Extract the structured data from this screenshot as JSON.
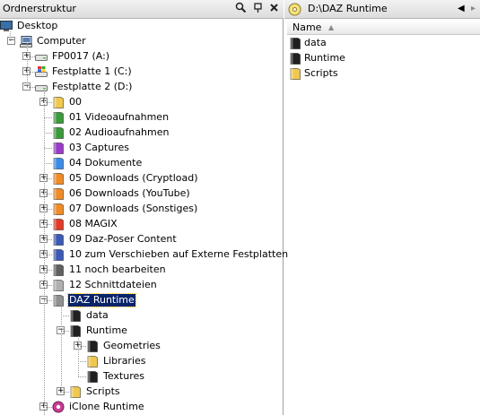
{
  "left_pane": {
    "title": "Ordnerstruktur",
    "buttons": [
      {
        "icon": "search-icon"
      },
      {
        "icon": "pin-icon"
      },
      {
        "icon": "close-icon"
      }
    ]
  },
  "tree": [
    {
      "label": "Desktop",
      "icon": "desktop-icon",
      "level": 0,
      "expander": "none",
      "color": "#3a6ea5"
    },
    {
      "label": "Computer",
      "icon": "computer-icon",
      "level": 1,
      "expander": "minus",
      "color": "#5b7fb0"
    },
    {
      "label": "FP0017 (A:)",
      "icon": "floppy-drive-icon",
      "level": 2,
      "expander": "plus",
      "color": "#a0a0a0"
    },
    {
      "label": "Festplatte 1 (C:)",
      "icon": "windows-drive-icon",
      "level": 2,
      "expander": "plus",
      "color": "#a0a0a0"
    },
    {
      "label": "Festplatte 2 (D:)",
      "icon": "hard-drive-icon",
      "level": 2,
      "expander": "minus",
      "color": "#a0a0a0"
    },
    {
      "label": "00",
      "icon": "folder-icon",
      "level": 3,
      "expander": "plus",
      "color": "#f0c850"
    },
    {
      "label": "01 Videoaufnahmen",
      "icon": "folder-icon",
      "level": 3,
      "expander": "none",
      "color": "#3c9a3c"
    },
    {
      "label": "02 Audioaufnahmen",
      "icon": "folder-icon",
      "level": 3,
      "expander": "none",
      "color": "#3c9a3c"
    },
    {
      "label": "03 Captures",
      "icon": "folder-icon",
      "level": 3,
      "expander": "none",
      "color": "#9a3cc8"
    },
    {
      "label": "04 Dokumente",
      "icon": "folder-icon",
      "level": 3,
      "expander": "none",
      "color": "#3c8ce6"
    },
    {
      "label": "05 Downloads (Cryptload)",
      "icon": "folder-icon",
      "level": 3,
      "expander": "plus",
      "color": "#f08c28"
    },
    {
      "label": "06 Downloads (YouTube)",
      "icon": "folder-icon",
      "level": 3,
      "expander": "plus",
      "color": "#f08c28"
    },
    {
      "label": "07 Downloads (Sonstiges)",
      "icon": "folder-icon",
      "level": 3,
      "expander": "plus",
      "color": "#f08c28"
    },
    {
      "label": "08 MAGIX",
      "icon": "folder-icon",
      "level": 3,
      "expander": "plus",
      "color": "#e03c28"
    },
    {
      "label": "09 Daz-Poser Content",
      "icon": "folder-icon",
      "level": 3,
      "expander": "plus",
      "color": "#3c5ab4"
    },
    {
      "label": "10 zum Verschieben auf Externe Festplatten",
      "icon": "folder-icon",
      "level": 3,
      "expander": "plus",
      "color": "#3c5ab4"
    },
    {
      "label": "11 noch bearbeiten",
      "icon": "folder-icon",
      "level": 3,
      "expander": "plus",
      "color": "#606060"
    },
    {
      "label": "12 Schnittdateien",
      "icon": "folder-icon",
      "level": 3,
      "expander": "plus",
      "color": "#b0b0b0"
    },
    {
      "label": "DAZ Runtime",
      "icon": "folder-icon",
      "level": 3,
      "expander": "minus",
      "color": "#909090",
      "selected": true
    },
    {
      "label": "data",
      "icon": "folder-icon",
      "level": 4,
      "expander": "none",
      "color": "#202020"
    },
    {
      "label": "Runtime",
      "icon": "folder-icon",
      "level": 4,
      "expander": "minus",
      "color": "#202020"
    },
    {
      "label": "Geometries",
      "icon": "folder-icon",
      "level": 5,
      "expander": "plus",
      "color": "#202020"
    },
    {
      "label": "Libraries",
      "icon": "folder-icon",
      "level": 5,
      "expander": "none",
      "color": "#f0c850"
    },
    {
      "label": "Textures",
      "icon": "folder-icon",
      "level": 5,
      "expander": "none",
      "color": "#202020"
    },
    {
      "label": "Scripts",
      "icon": "folder-icon",
      "level": 4,
      "expander": "plus",
      "color": "#f0c850"
    },
    {
      "label": "iClone Runtime",
      "icon": "iclone-folder-icon",
      "level": 3,
      "expander": "plus",
      "color": "#c83c96"
    }
  ],
  "right_pane": {
    "address": "D:\\DAZ Runtime",
    "column_name": "Name",
    "files": [
      {
        "label": "data",
        "icon": "folder-icon",
        "color": "#202020"
      },
      {
        "label": "Runtime",
        "icon": "folder-icon",
        "color": "#202020"
      },
      {
        "label": "Scripts",
        "icon": "folder-icon",
        "color": "#f0c850"
      }
    ]
  }
}
